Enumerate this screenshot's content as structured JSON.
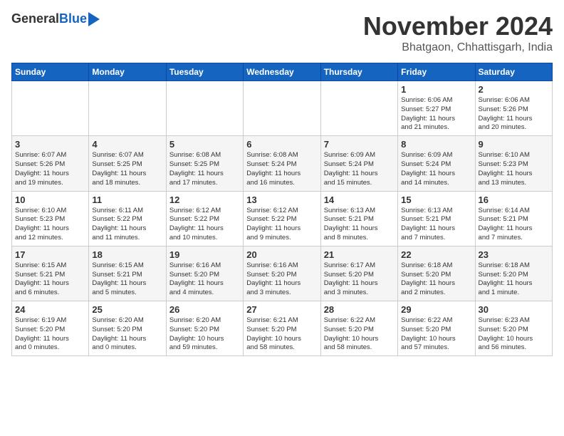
{
  "header": {
    "logo_general": "General",
    "logo_blue": "Blue",
    "month_title": "November 2024",
    "location": "Bhatgaon, Chhattisgarh, India"
  },
  "weekdays": [
    "Sunday",
    "Monday",
    "Tuesday",
    "Wednesday",
    "Thursday",
    "Friday",
    "Saturday"
  ],
  "weeks": [
    [
      {
        "day": "",
        "info": ""
      },
      {
        "day": "",
        "info": ""
      },
      {
        "day": "",
        "info": ""
      },
      {
        "day": "",
        "info": ""
      },
      {
        "day": "",
        "info": ""
      },
      {
        "day": "1",
        "info": "Sunrise: 6:06 AM\nSunset: 5:27 PM\nDaylight: 11 hours\nand 21 minutes."
      },
      {
        "day": "2",
        "info": "Sunrise: 6:06 AM\nSunset: 5:26 PM\nDaylight: 11 hours\nand 20 minutes."
      }
    ],
    [
      {
        "day": "3",
        "info": "Sunrise: 6:07 AM\nSunset: 5:26 PM\nDaylight: 11 hours\nand 19 minutes."
      },
      {
        "day": "4",
        "info": "Sunrise: 6:07 AM\nSunset: 5:25 PM\nDaylight: 11 hours\nand 18 minutes."
      },
      {
        "day": "5",
        "info": "Sunrise: 6:08 AM\nSunset: 5:25 PM\nDaylight: 11 hours\nand 17 minutes."
      },
      {
        "day": "6",
        "info": "Sunrise: 6:08 AM\nSunset: 5:24 PM\nDaylight: 11 hours\nand 16 minutes."
      },
      {
        "day": "7",
        "info": "Sunrise: 6:09 AM\nSunset: 5:24 PM\nDaylight: 11 hours\nand 15 minutes."
      },
      {
        "day": "8",
        "info": "Sunrise: 6:09 AM\nSunset: 5:24 PM\nDaylight: 11 hours\nand 14 minutes."
      },
      {
        "day": "9",
        "info": "Sunrise: 6:10 AM\nSunset: 5:23 PM\nDaylight: 11 hours\nand 13 minutes."
      }
    ],
    [
      {
        "day": "10",
        "info": "Sunrise: 6:10 AM\nSunset: 5:23 PM\nDaylight: 11 hours\nand 12 minutes."
      },
      {
        "day": "11",
        "info": "Sunrise: 6:11 AM\nSunset: 5:22 PM\nDaylight: 11 hours\nand 11 minutes."
      },
      {
        "day": "12",
        "info": "Sunrise: 6:12 AM\nSunset: 5:22 PM\nDaylight: 11 hours\nand 10 minutes."
      },
      {
        "day": "13",
        "info": "Sunrise: 6:12 AM\nSunset: 5:22 PM\nDaylight: 11 hours\nand 9 minutes."
      },
      {
        "day": "14",
        "info": "Sunrise: 6:13 AM\nSunset: 5:21 PM\nDaylight: 11 hours\nand 8 minutes."
      },
      {
        "day": "15",
        "info": "Sunrise: 6:13 AM\nSunset: 5:21 PM\nDaylight: 11 hours\nand 7 minutes."
      },
      {
        "day": "16",
        "info": "Sunrise: 6:14 AM\nSunset: 5:21 PM\nDaylight: 11 hours\nand 7 minutes."
      }
    ],
    [
      {
        "day": "17",
        "info": "Sunrise: 6:15 AM\nSunset: 5:21 PM\nDaylight: 11 hours\nand 6 minutes."
      },
      {
        "day": "18",
        "info": "Sunrise: 6:15 AM\nSunset: 5:21 PM\nDaylight: 11 hours\nand 5 minutes."
      },
      {
        "day": "19",
        "info": "Sunrise: 6:16 AM\nSunset: 5:20 PM\nDaylight: 11 hours\nand 4 minutes."
      },
      {
        "day": "20",
        "info": "Sunrise: 6:16 AM\nSunset: 5:20 PM\nDaylight: 11 hours\nand 3 minutes."
      },
      {
        "day": "21",
        "info": "Sunrise: 6:17 AM\nSunset: 5:20 PM\nDaylight: 11 hours\nand 3 minutes."
      },
      {
        "day": "22",
        "info": "Sunrise: 6:18 AM\nSunset: 5:20 PM\nDaylight: 11 hours\nand 2 minutes."
      },
      {
        "day": "23",
        "info": "Sunrise: 6:18 AM\nSunset: 5:20 PM\nDaylight: 11 hours\nand 1 minute."
      }
    ],
    [
      {
        "day": "24",
        "info": "Sunrise: 6:19 AM\nSunset: 5:20 PM\nDaylight: 11 hours\nand 0 minutes."
      },
      {
        "day": "25",
        "info": "Sunrise: 6:20 AM\nSunset: 5:20 PM\nDaylight: 11 hours\nand 0 minutes."
      },
      {
        "day": "26",
        "info": "Sunrise: 6:20 AM\nSunset: 5:20 PM\nDaylight: 10 hours\nand 59 minutes."
      },
      {
        "day": "27",
        "info": "Sunrise: 6:21 AM\nSunset: 5:20 PM\nDaylight: 10 hours\nand 58 minutes."
      },
      {
        "day": "28",
        "info": "Sunrise: 6:22 AM\nSunset: 5:20 PM\nDaylight: 10 hours\nand 58 minutes."
      },
      {
        "day": "29",
        "info": "Sunrise: 6:22 AM\nSunset: 5:20 PM\nDaylight: 10 hours\nand 57 minutes."
      },
      {
        "day": "30",
        "info": "Sunrise: 6:23 AM\nSunset: 5:20 PM\nDaylight: 10 hours\nand 56 minutes."
      }
    ]
  ]
}
